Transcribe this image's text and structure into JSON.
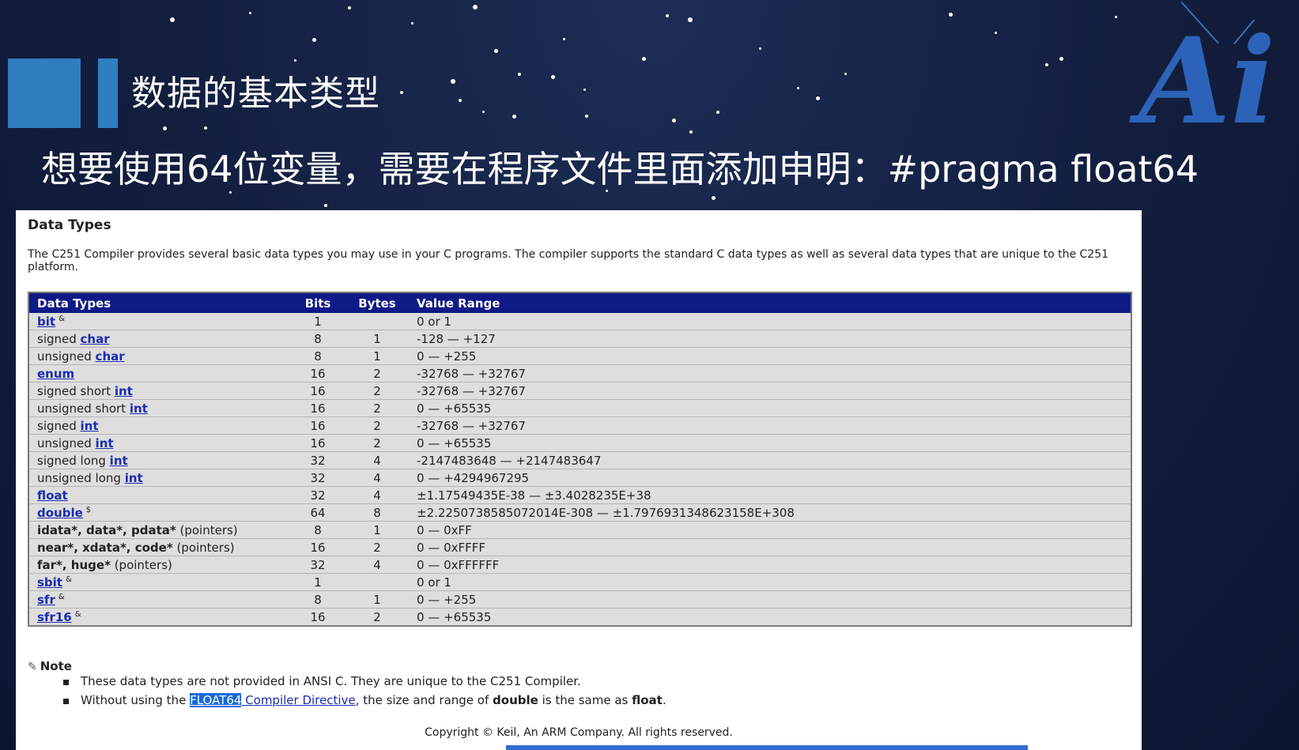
{
  "slide": {
    "title": "数据的基本类型",
    "subtitle": "想要使用64位变量，需要在程序文件里面添加申明：#pragma float64",
    "logo_text": "Ai"
  },
  "doc": {
    "heading": "Data Types",
    "intro": "The C251 Compiler provides several basic data types you may use in your C programs. The compiler supports the standard C data types as well as several data types that are unique to the C251 platform.",
    "columns": [
      "Data Types",
      "Bits",
      "Bytes",
      "Value Range"
    ],
    "rows": [
      {
        "pre": "",
        "link": "bit",
        "post": "",
        "sup": "&",
        "bits": "1",
        "bytes": "",
        "range": "0 or 1"
      },
      {
        "pre": "signed ",
        "link": "char",
        "post": "",
        "sup": "",
        "bits": "8",
        "bytes": "1",
        "range": "-128 — +127"
      },
      {
        "pre": "unsigned ",
        "link": "char",
        "post": "",
        "sup": "",
        "bits": "8",
        "bytes": "1",
        "range": "0 — +255"
      },
      {
        "pre": "",
        "link": "enum",
        "post": "",
        "sup": "",
        "bits": "16",
        "bytes": "2",
        "range": "-32768 — +32767"
      },
      {
        "pre": "signed short ",
        "link": "int",
        "post": "",
        "sup": "",
        "bits": "16",
        "bytes": "2",
        "range": "-32768 — +32767"
      },
      {
        "pre": "unsigned short ",
        "link": "int",
        "post": "",
        "sup": "",
        "bits": "16",
        "bytes": "2",
        "range": "0 — +65535"
      },
      {
        "pre": "signed ",
        "link": "int",
        "post": "",
        "sup": "",
        "bits": "16",
        "bytes": "2",
        "range": "-32768 — +32767"
      },
      {
        "pre": "unsigned ",
        "link": "int",
        "post": "",
        "sup": "",
        "bits": "16",
        "bytes": "2",
        "range": "0 — +65535"
      },
      {
        "pre": "signed long ",
        "link": "int",
        "post": "",
        "sup": "",
        "bits": "32",
        "bytes": "4",
        "range": "-2147483648 — +2147483647"
      },
      {
        "pre": "unsigned long ",
        "link": "int",
        "post": "",
        "sup": "",
        "bits": "32",
        "bytes": "4",
        "range": "0 — +4294967295"
      },
      {
        "pre": "",
        "link": "float",
        "post": "",
        "sup": "",
        "bits": "32",
        "bytes": "4",
        "range": "±1.17549435E-38 — ±3.4028235E+38"
      },
      {
        "pre": "",
        "link": "double",
        "post": "",
        "sup": "$",
        "bits": "64",
        "bytes": "8",
        "range": "±2.2250738585072014E-308 — ±1.7976931348623158E+308"
      },
      {
        "bold": "idata*, data*, pdata*",
        "post": " (pointers)",
        "bits": "8",
        "bytes": "1",
        "range": "0 — 0xFF"
      },
      {
        "bold": "near*, xdata*, code*",
        "post": " (pointers)",
        "bits": "16",
        "bytes": "2",
        "range": "0 — 0xFFFF"
      },
      {
        "bold": "far*, huge*",
        "post": " (pointers)",
        "bits": "32",
        "bytes": "4",
        "range": "0 — 0xFFFFFF"
      },
      {
        "pre": "",
        "link": "sbit",
        "post": "",
        "sup": "&",
        "bits": "1",
        "bytes": "",
        "range": "0 or 1"
      },
      {
        "pre": "",
        "link": "sfr",
        "post": "",
        "sup": "&",
        "bits": "8",
        "bytes": "1",
        "range": "0 — +255"
      },
      {
        "pre": "",
        "link": "sfr16",
        "post": "",
        "sup": "&",
        "bits": "16",
        "bytes": "2",
        "range": "0 — +65535"
      }
    ],
    "note_label": "Note",
    "notes": {
      "n1": "These data types are not provided in ANSI C. They are unique to the C251 Compiler.",
      "n2_pre": "Without using the ",
      "n2_highlight": "FLOAT64",
      "n2_link": " Compiler Directive",
      "n2_mid": ", the size and range of ",
      "n2_b1": "double",
      "n2_mid2": " is the same as ",
      "n2_b2": "float",
      "n2_end": "."
    },
    "copyright": "Copyright © Keil, An ARM Company. All rights reserved."
  },
  "colors": {
    "accent_blue": "#2f7ebf",
    "table_header": "#0f1a86",
    "link": "#1c2cb0"
  }
}
